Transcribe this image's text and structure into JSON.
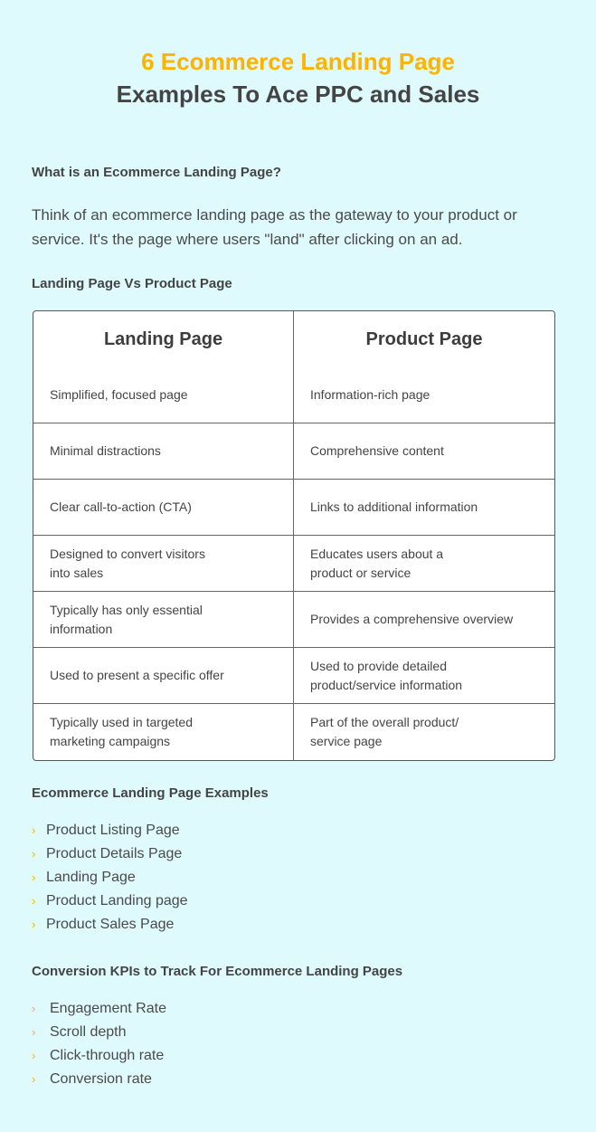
{
  "title": {
    "line1": "6 Ecommerce Landing Page",
    "line2": "Examples To Ace PPC and Sales"
  },
  "section_what": {
    "heading": "What is an Ecommerce Landing Page?",
    "paragraph": "Think of an ecommerce landing page as the gateway to your product or service. It's the page where users \"land\" after clicking on an ad."
  },
  "section_compare": {
    "heading": "Landing Page Vs Product Page",
    "columns": [
      "Landing Page",
      "Product Page"
    ],
    "rows": [
      [
        "Simplified, focused page",
        "Information-rich page"
      ],
      [
        "Minimal distractions",
        "Comprehensive content"
      ],
      [
        "Clear call-to-action (CTA)",
        "Links to additional information"
      ],
      [
        "Designed to convert visitors into sales",
        "Educates users about a product or service"
      ],
      [
        "Typically has only essential information",
        "Provides a comprehensive overview"
      ],
      [
        "Used to present a specific offer",
        "Used to provide detailed product/service information"
      ],
      [
        "Typically used in targeted marketing campaigns",
        "Part of the overall product/ service page"
      ]
    ]
  },
  "section_examples": {
    "heading": "Ecommerce Landing Page Examples",
    "items": [
      "Product Listing Page",
      "Product Details Page",
      "Landing Page",
      "Product Landing page",
      "Product Sales Page"
    ]
  },
  "section_kpis": {
    "heading": "Conversion KPIs to Track For Ecommerce Landing Pages",
    "items": [
      "Engagement Rate",
      "Scroll depth",
      "Click-through rate",
      "Conversion rate"
    ]
  },
  "icons": {
    "bullet": "chevron-right-icon",
    "bullet_glyph": "›"
  },
  "colors": {
    "accent": "#fdb300",
    "background": "#dffafc",
    "text": "#444444"
  }
}
